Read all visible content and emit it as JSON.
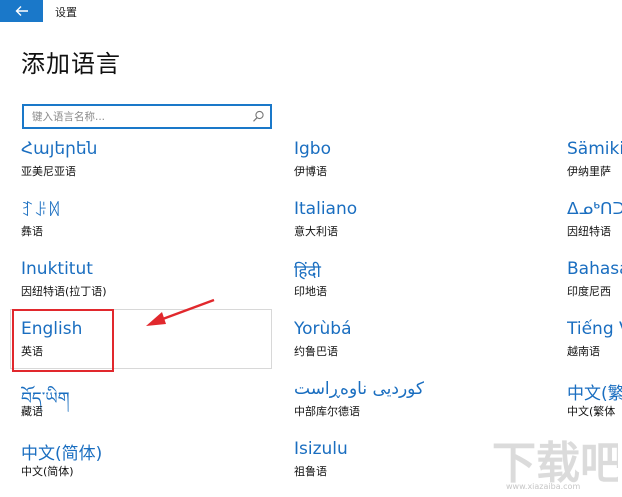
{
  "window": {
    "title": "设置",
    "back_icon": "back-arrow-icon"
  },
  "page": {
    "title": "添加语言"
  },
  "search": {
    "placeholder": "键入语言名称...",
    "icon": "search-icon"
  },
  "colors": {
    "accent": "#1a78c9",
    "link": "#1a6ec0",
    "annotation": "#e1282d"
  },
  "languages": [
    {
      "name": "Հայերեն",
      "sub": "亚美尼亚语"
    },
    {
      "name": "ꆈꌠꉙ",
      "sub": "彝语"
    },
    {
      "name": "Inuktitut",
      "sub": "因纽特语(拉丁语)"
    },
    {
      "name": "English",
      "sub": "英语"
    },
    {
      "name": "བོད་ཡིག",
      "sub": "藏语"
    },
    {
      "name": "中文(简体)",
      "sub": "中文(简体)"
    },
    {
      "name": "Igbo",
      "sub": "伊博语"
    },
    {
      "name": "Italiano",
      "sub": "意大利语"
    },
    {
      "name": "हिंदी",
      "sub": "印地语"
    },
    {
      "name": "Yorùbá",
      "sub": "约鲁巴语"
    },
    {
      "name": "کوردیی ناوەڕاست",
      "sub": "中部库尔德语"
    },
    {
      "name": "Isizulu",
      "sub": "祖鲁语"
    },
    {
      "name": "Sämiki",
      "sub": "伊纳里萨"
    },
    {
      "name": "ᐃᓄᒃᑎᑐᑦ",
      "sub": "因纽特语"
    },
    {
      "name": "Bahasa",
      "sub": "印度尼西"
    },
    {
      "name": "Tiếng V",
      "sub": "越南语"
    },
    {
      "name": "中文(繁",
      "sub": "中文(繁体"
    }
  ],
  "watermark": {
    "text": "下载吧",
    "url": "www.xiazaiba.com"
  }
}
